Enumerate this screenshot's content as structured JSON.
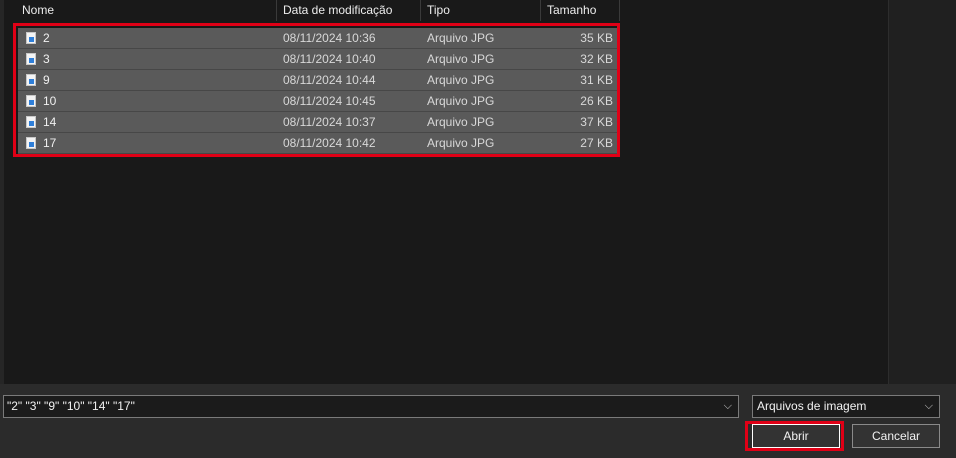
{
  "columns": {
    "name": "Nome",
    "date": "Data de modificação",
    "type": "Tipo",
    "size": "Tamanho"
  },
  "files": [
    {
      "name": "2",
      "date": "08/11/2024 10:36",
      "type": "Arquivo JPG",
      "size": "35 KB"
    },
    {
      "name": "3",
      "date": "08/11/2024 10:40",
      "type": "Arquivo JPG",
      "size": "32 KB"
    },
    {
      "name": "9",
      "date": "08/11/2024 10:44",
      "type": "Arquivo JPG",
      "size": "31 KB"
    },
    {
      "name": "10",
      "date": "08/11/2024 10:45",
      "type": "Arquivo JPG",
      "size": "26 KB"
    },
    {
      "name": "14",
      "date": "08/11/2024 10:37",
      "type": "Arquivo JPG",
      "size": "37 KB"
    },
    {
      "name": "17",
      "date": "08/11/2024 10:42",
      "type": "Arquivo JPG",
      "size": "27 KB"
    }
  ],
  "footer": {
    "filename_value": "\"2\" \"3\" \"9\" \"10\" \"14\" \"17\"",
    "filetype_selected": "Arquivos de imagem",
    "open_label": "Abrir",
    "cancel_label": "Cancelar"
  },
  "icons": {
    "file": "jpg-file-icon",
    "dropdown": "chevron-down-icon",
    "sort": "sort-caret-icon"
  },
  "colors": {
    "highlight": "#e00016",
    "selected_row": "#5a5a5a",
    "background": "#191919"
  }
}
